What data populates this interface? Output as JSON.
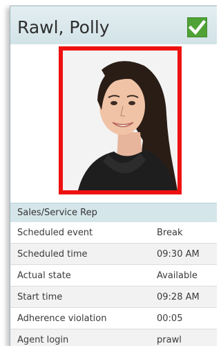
{
  "agent": {
    "name": "Rawl, Polly",
    "status_icon": "green-check-icon",
    "photo_border_color": "#ee1111",
    "role": "Sales/Service Rep"
  },
  "details": [
    {
      "label": "Scheduled event",
      "value": "Break"
    },
    {
      "label": "Scheduled time",
      "value": "09:30 AM"
    },
    {
      "label": "Actual state",
      "value": "Available"
    },
    {
      "label": "Start time",
      "value": "09:28 AM"
    },
    {
      "label": "Adherence violation",
      "value": "00:05"
    },
    {
      "label": "Agent login",
      "value": "prawl"
    }
  ]
}
